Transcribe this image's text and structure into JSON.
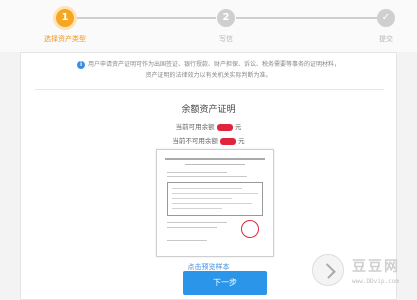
{
  "stepper": {
    "steps": [
      {
        "num": "1",
        "label": "选择资产类型",
        "status": "active"
      },
      {
        "num": "2",
        "label": "写信",
        "status": "idle"
      },
      {
        "num": "✓",
        "label": "提交",
        "status": "idle"
      }
    ]
  },
  "notice": {
    "line1": "用户申请资产证明可作为出国签证、银行授款、财产担保、诉讼、税务需要等事务的证明材料，",
    "line2": "资产证明的法律效力以有关机关实际判断为准。"
  },
  "certificate": {
    "title": "余额资产证明",
    "line1_prefix": "当前可用余额",
    "line1_suffix": "元",
    "line2_prefix": "当前不可用余额",
    "line2_suffix": "元"
  },
  "sample_link": "点击预览样本",
  "next_button": "下一步",
  "watermark": {
    "title": "豆豆网",
    "url": "www.DDvip.com"
  },
  "colors": {
    "accent": "#f5a623",
    "primary": "#2b95e9",
    "redaction": "#e0243b"
  }
}
